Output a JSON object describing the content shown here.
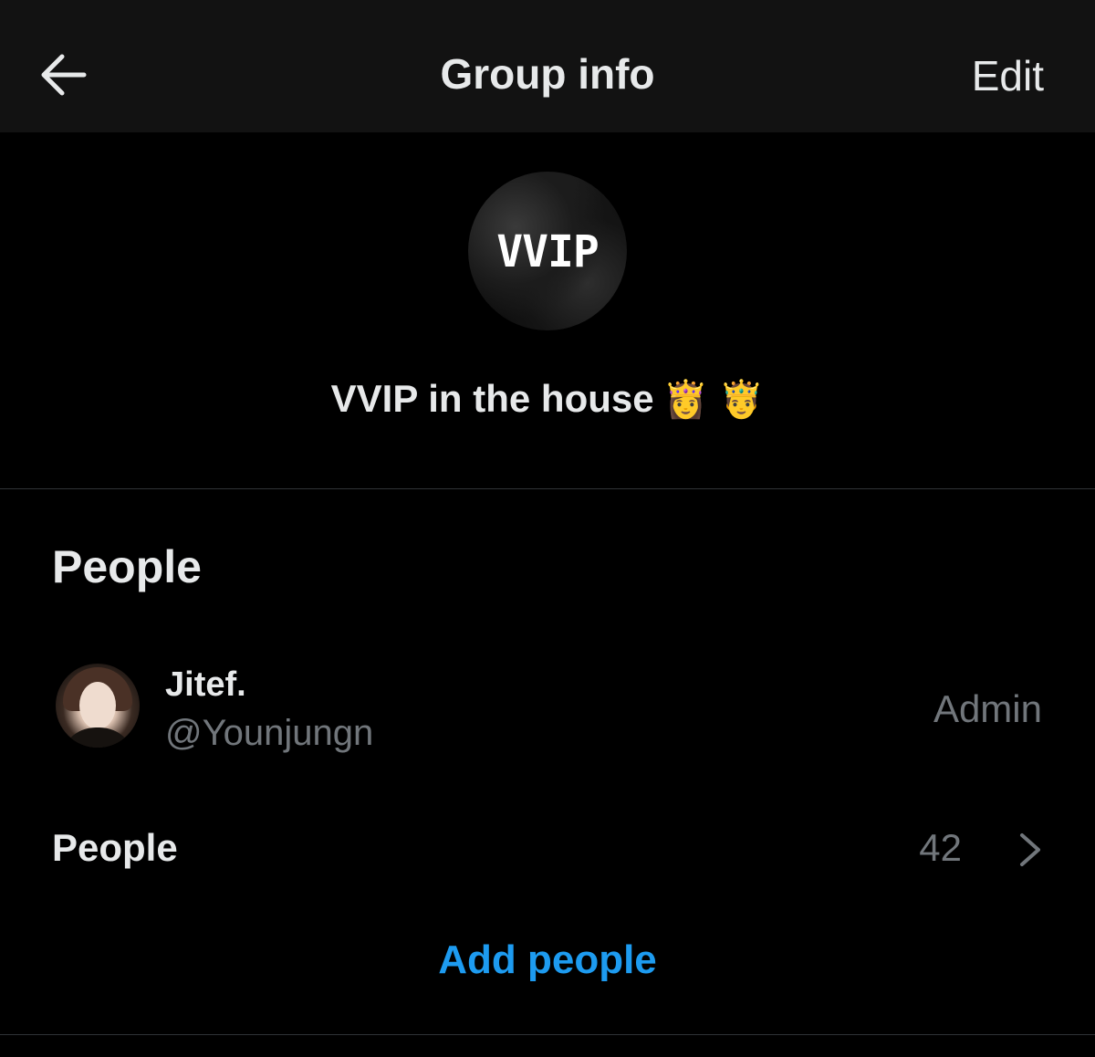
{
  "header": {
    "title": "Group info",
    "edit_label": "Edit",
    "back_icon": "arrow-left-icon"
  },
  "group": {
    "avatar_text": "VVIP",
    "name": "VVIP in the house",
    "emojis": "👸 🤴"
  },
  "people_section": {
    "title": "People",
    "members": [
      {
        "name": "Jitef.",
        "handle": "@Younjungn",
        "role": "Admin"
      }
    ],
    "people_row": {
      "label": "People",
      "count": "42",
      "chevron_icon": "chevron-right-icon"
    },
    "add_people_label": "Add people"
  },
  "colors": {
    "background": "#000000",
    "header_background": "#121212",
    "primary_text": "#e7e9ea",
    "secondary_text": "#71767b",
    "accent": "#1d9bf0",
    "divider": "#2f3336"
  }
}
